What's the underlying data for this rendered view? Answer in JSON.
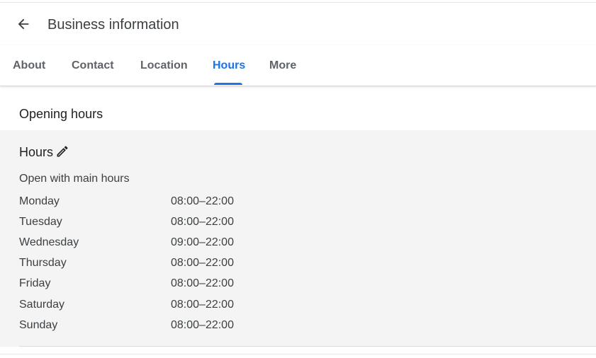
{
  "header": {
    "title": "Business information",
    "back_icon": "arrow-back-icon"
  },
  "tabs": [
    {
      "label": "About"
    },
    {
      "label": "Contact"
    },
    {
      "label": "Location"
    },
    {
      "label": "Hours",
      "active": true
    },
    {
      "label": "More"
    }
  ],
  "colors": {
    "accent": "#1a73e8",
    "card_background": "#f4f4f4",
    "tab_inactive": "#5f6368"
  },
  "opening_hours": {
    "section_title": "Opening hours",
    "hours_title": "Hours",
    "edit_icon": "pencil-icon",
    "subtitle": "Open with main hours",
    "days": [
      {
        "day": "Monday",
        "hours": "08:00–22:00"
      },
      {
        "day": "Tuesday",
        "hours": "08:00–22:00"
      },
      {
        "day": "Wednesday",
        "hours": "09:00–22:00"
      },
      {
        "day": "Thursday",
        "hours": "08:00–22:00"
      },
      {
        "day": "Friday",
        "hours": "08:00–22:00"
      },
      {
        "day": "Saturday",
        "hours": "08:00–22:00"
      },
      {
        "day": "Sunday",
        "hours": "08:00–22:00"
      }
    ]
  }
}
